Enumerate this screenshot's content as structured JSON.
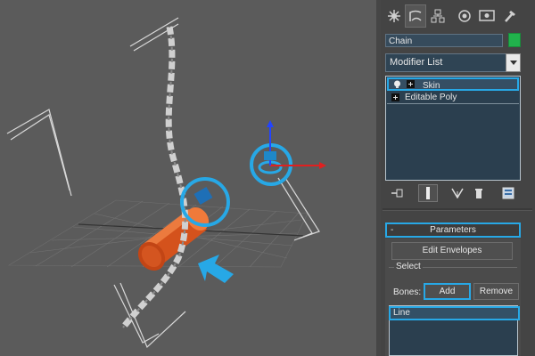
{
  "viewport": {
    "label": "3D viewport",
    "scene_objects": [
      "chain",
      "cylinder",
      "grid",
      "bone-helper",
      "transform-gizmo"
    ],
    "colors": {
      "background": "#5b5b5b",
      "chain": "#c8c8c8",
      "cylinder": "#e0581f",
      "highlight": "#27a8e6",
      "gizmo_x": "#e02020",
      "gizmo_z": "#1e44ff"
    }
  },
  "command_panel": {
    "tabs": [
      {
        "icon": "create-icon"
      },
      {
        "icon": "modify-icon"
      },
      {
        "icon": "hierarchy-icon"
      },
      {
        "icon": "motion-icon"
      },
      {
        "icon": "display-icon"
      },
      {
        "icon": "utilities-icon"
      }
    ],
    "object_name": "Chain",
    "object_color": "#21b24c",
    "modifier_list": {
      "value": "Modifier List"
    },
    "stack": [
      {
        "label": "Skin",
        "selected": true,
        "icon": "lightbulb-icon"
      },
      {
        "label": "Editable Poly",
        "selected": false,
        "icon": "plus-icon"
      }
    ],
    "stack_tools": [
      {
        "icon": "pin-stack-icon"
      },
      {
        "icon": "show-end-result-icon"
      },
      {
        "icon": "make-unique-icon"
      },
      {
        "icon": "remove-modifier-icon"
      },
      {
        "icon": "configure-sets-icon"
      }
    ],
    "rollout": {
      "toggle": "-",
      "title": "Parameters",
      "edit_envelopes": "Edit Envelopes",
      "select_group": "Select",
      "bones_label": "Bones:",
      "add": "Add",
      "remove": "Remove",
      "bones": [
        "Line"
      ]
    }
  }
}
